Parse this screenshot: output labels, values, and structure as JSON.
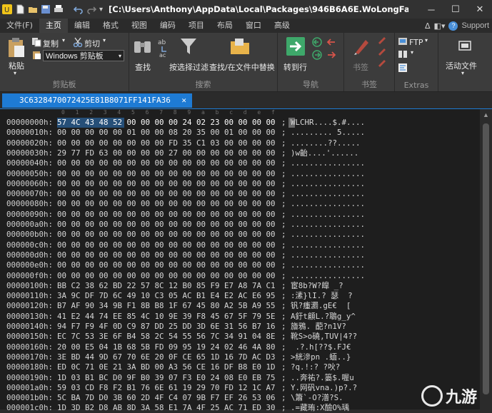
{
  "window": {
    "title": "[C:\\Users\\Anthony\\AppData\\Local\\Packages\\946B6A6E.WoLongFalle...",
    "minimize": "─",
    "maximize": "☐",
    "close": "✕"
  },
  "menu": {
    "items": [
      "文件(F)",
      "主页",
      "编辑",
      "格式",
      "视图",
      "编码",
      "项目",
      "布局",
      "窗口",
      "高级"
    ],
    "active_index": 1,
    "support": "Support"
  },
  "ribbon": {
    "clipboard": {
      "paste": "粘贴",
      "copy": "复制",
      "cut": "剪切",
      "clipboard_select": "Windows 剪贴板",
      "label": "剪贴板"
    },
    "search": {
      "find": "找",
      "find_full": "查找",
      "filter": "按选择过滤",
      "find_in_files": "查找/在文件中替换",
      "label": "搜索"
    },
    "navigation": {
      "goto": "转到行",
      "label": "导航"
    },
    "bookmarks": {
      "bookmark": "书签",
      "label": "书签"
    },
    "extras": {
      "ftp": "FTP",
      "label": "Extras"
    },
    "active_files": {
      "label": "活动文件"
    }
  },
  "tab": {
    "filename": "3C6328470072425E81B8071FF141FA36",
    "close": "✕"
  },
  "ruler": [
    "0",
    "1",
    "2",
    "3",
    "4",
    "5",
    "6",
    "7",
    "8",
    "9",
    "a",
    "b",
    "c",
    "d",
    "e",
    "f"
  ],
  "hex_rows": [
    {
      "addr": "00000000h:",
      "hex": "57 4C 43 48 52 00 00 00 00 24 02 23 00 00 00 00",
      "ascii": "; WLCHR....$.#...."
    },
    {
      "addr": "00000010h:",
      "hex": "00 00 00 00 00 01 00 00 08 20 35 00 01 00 00 00",
      "ascii": "; ......... 5....."
    },
    {
      "addr": "00000020h:",
      "hex": "00 00 00 00 00 00 00 00 FD 35 C1 03 00 00 00 00",
      "ascii": "; ........??....."
    },
    {
      "addr": "00000030h:",
      "hex": "29 77 FD 63 00 00 00 00 27 00 00 00 00 00 00 00",
      "ascii": "; )w齝....'......"
    },
    {
      "addr": "00000040h:",
      "hex": "00 00 00 00 00 00 00 00 00 00 00 00 00 00 00 00",
      "ascii": "; ................"
    },
    {
      "addr": "00000050h:",
      "hex": "00 00 00 00 00 00 00 00 00 00 00 00 00 00 00 00",
      "ascii": "; ................"
    },
    {
      "addr": "00000060h:",
      "hex": "00 00 00 00 00 00 00 00 00 00 00 00 00 00 00 00",
      "ascii": "; ................"
    },
    {
      "addr": "00000070h:",
      "hex": "00 00 00 00 00 00 00 00 00 00 00 00 00 00 00 00",
      "ascii": "; ................"
    },
    {
      "addr": "00000080h:",
      "hex": "00 00 00 00 00 00 00 00 00 00 00 00 00 00 00 00",
      "ascii": "; ................"
    },
    {
      "addr": "00000090h:",
      "hex": "00 00 00 00 00 00 00 00 00 00 00 00 00 00 00 00",
      "ascii": "; ................"
    },
    {
      "addr": "000000a0h:",
      "hex": "00 00 00 00 00 00 00 00 00 00 00 00 00 00 00 00",
      "ascii": "; ................"
    },
    {
      "addr": "000000b0h:",
      "hex": "00 00 00 00 00 00 00 00 00 00 00 00 00 00 00 00",
      "ascii": "; ................"
    },
    {
      "addr": "000000c0h:",
      "hex": "00 00 00 00 00 00 00 00 00 00 00 00 00 00 00 00",
      "ascii": "; ................"
    },
    {
      "addr": "000000d0h:",
      "hex": "00 00 00 00 00 00 00 00 00 00 00 00 00 00 00 00",
      "ascii": "; ................"
    },
    {
      "addr": "000000e0h:",
      "hex": "00 00 00 00 00 00 00 00 00 00 00 00 00 00 00 00",
      "ascii": "; ................"
    },
    {
      "addr": "000000f0h:",
      "hex": "00 00 00 00 00 00 00 00 00 00 00 00 00 00 00 00",
      "ascii": "; ................"
    },
    {
      "addr": "00000100h:",
      "hex": "BB C2 38 62 BD 22 57 8C 12 B0 85 F9 E7 A8 7A C1",
      "ascii": "; 宦8b?W?皡 _?"
    },
    {
      "addr": "00000110h:",
      "hex": "3A 9C DF 7D 6C 49 10 C3 05 AC B1 E4 E2 AC E6 95",
      "ascii": "; :溸}lI.? 瑟  ?"
    },
    {
      "addr": "00000120h:",
      "hex": "B7 AF 90 34 9B F1 8B B8 1F 67 45 80 A2 5B A9 55",
      "ascii": "; 钒?瘇瀱.gE€  ["
    },
    {
      "addr": "00000130h:",
      "hex": "41 E2 44 74 EE 85 4C 10 9E 39 F8 45 67 5F 79 5E",
      "ascii": "; A釪t顅L.?鵈g_y^"
    },
    {
      "addr": "00000140h:",
      "hex": "94 F7 F9 4F 0D C9 87 DD 25 DD 3D 6E 31 56 B7 16",
      "ascii": "; 旝鴉. 蓜?n1V?"
    },
    {
      "addr": "00000150h:",
      "hex": "EC 7C 53 3E 6F B4 58 2C 54 55 56 7C 34 91 04 8E",
      "ascii": "; 靴S>o磽,TUV|4??"
    },
    {
      "addr": "00000160h:",
      "hex": "20 00 E5 04 1B 68 5B FD 09 95 19 24 02 46 4A 80",
      "ascii": ";  .?.h[??$.FJ€"
    },
    {
      "addr": "00000170h:",
      "hex": "3E BD 44 9D 67 70 6E 20 0F CE 65 1D 16 7D AC D3",
      "ascii": "; >絖滲pn .蝒..}"
    },
    {
      "addr": "00000180h:",
      "hex": "ED 0C 71 0E 21 3A BD 00 A3 56 CE 16 DF B8 E0 1D",
      "ascii": "; ?q.!:? ?吙?"
    },
    {
      "addr": "00000190h:",
      "hex": "1D 03 B1 BC D0 9F B0 39 07 F3 E0 24 08 E0 EB 75",
      "ascii": "; ..奔祐?.篓$.喔u"
    },
    {
      "addr": "000001a0h:",
      "hex": "59 03 CD F8 F2 B1 76 6E 61 19 29 70 FD 12 1C A7",
      "ascii": "; Y.网矾vna.)p?.?"
    },
    {
      "addr": "000001b0h:",
      "hex": "5C BA 7D D0 3B 60 2D 4F C4 07 9B F7 EF 26 53 06",
      "ascii": "; \\簫`-O?潽?S."
    },
    {
      "addr": "000001c0h:",
      "hex": "1D 3D B2 D8 AB 8D 3A 58 E1 7A 4F 25 AC 71 ED 30",
      "ascii": "; .=藏珛:X醶O%瑀"
    }
  ],
  "watermark": {
    "text": "九游"
  }
}
